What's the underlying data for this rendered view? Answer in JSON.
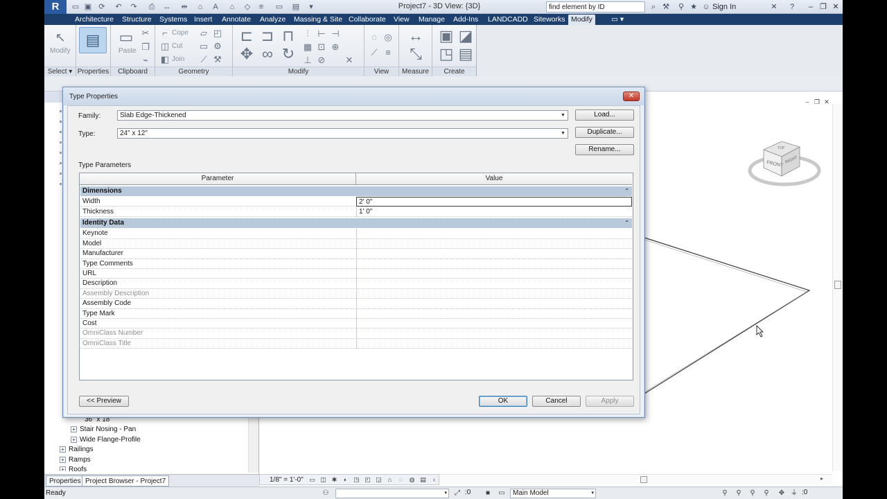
{
  "window": {
    "title": "Project7 - 3D View: {3D}"
  },
  "search": {
    "value": "find element by ID"
  },
  "account": {
    "sign_in": "Sign In"
  },
  "tabs": [
    {
      "label": "Architecture"
    },
    {
      "label": "Structure"
    },
    {
      "label": "Systems"
    },
    {
      "label": "Insert"
    },
    {
      "label": "Annotate"
    },
    {
      "label": "Analyze"
    },
    {
      "label": "Massing & Site"
    },
    {
      "label": "Collaborate"
    },
    {
      "label": "View"
    },
    {
      "label": "Manage"
    },
    {
      "label": "Add-Ins"
    },
    {
      "label": "LANDCADD"
    },
    {
      "label": "Siteworks"
    },
    {
      "label": "Modify"
    }
  ],
  "ribbon": {
    "modify_label": "Modify",
    "paste_label": "Paste",
    "cope_label": "Cope",
    "cut_label": "Cut",
    "join_label": "Join",
    "panels": {
      "select": "Select",
      "properties": "Properties",
      "clipboard": "Clipboard",
      "geometry": "Geometry",
      "modify": "Modify",
      "view": "View",
      "measure": "Measure",
      "create": "Create"
    }
  },
  "browser": {
    "header": "Project Browser - Project7",
    "tree": [
      {
        "label": "36\" x 18\"",
        "toggle": ""
      },
      {
        "label": "Stair Nosing - Pan",
        "toggle": "+"
      },
      {
        "label": "Wide Flange-Profile",
        "toggle": "+"
      },
      {
        "label": "Railings",
        "toggle": "+"
      },
      {
        "label": "Ramps",
        "toggle": "+"
      },
      {
        "label": "Roofs",
        "toggle": "+"
      }
    ],
    "tabs": [
      {
        "label": "Properties"
      },
      {
        "label": "Project Browser - Project7"
      }
    ]
  },
  "view": {
    "scale": "1/8\" = 1'-0\""
  },
  "status": {
    "text": "Ready",
    "coord": ":0",
    "model": "Main Model",
    "filter": ":0"
  },
  "dialog": {
    "title": "Type Properties",
    "family_label": "Family:",
    "family_value": "Slab Edge-Thickened",
    "type_label": "Type:",
    "type_value": "24\" x 12\"",
    "load_btn": "Load...",
    "duplicate_btn": "Duplicate...",
    "rename_btn": "Rename...",
    "type_params_label": "Type Parameters",
    "col_parameter": "Parameter",
    "col_value": "Value",
    "groups": [
      {
        "name": "Dimensions",
        "rows": [
          {
            "name": "Width",
            "value": "2'  0\"",
            "dim": false
          },
          {
            "name": "Thickness",
            "value": "1'  0\"",
            "dim": false
          }
        ]
      },
      {
        "name": "Identity Data",
        "rows": [
          {
            "name": "Keynote",
            "value": "",
            "dim": false
          },
          {
            "name": "Model",
            "value": "",
            "dim": false
          },
          {
            "name": "Manufacturer",
            "value": "",
            "dim": false
          },
          {
            "name": "Type Comments",
            "value": "",
            "dim": false
          },
          {
            "name": "URL",
            "value": "",
            "dim": false
          },
          {
            "name": "Description",
            "value": "",
            "dim": false
          },
          {
            "name": "Assembly Description",
            "value": "",
            "dim": true
          },
          {
            "name": "Assembly Code",
            "value": "",
            "dim": false
          },
          {
            "name": "Type Mark",
            "value": "",
            "dim": false
          },
          {
            "name": "Cost",
            "value": "",
            "dim": false
          },
          {
            "name": "OmniClass Number",
            "value": "",
            "dim": true
          },
          {
            "name": "OmniClass Title",
            "value": "",
            "dim": true
          }
        ]
      }
    ],
    "preview_btn": "<< Preview",
    "ok_btn": "OK",
    "cancel_btn": "Cancel",
    "apply_btn": "Apply"
  },
  "viewcube": {
    "front": "FRONT",
    "right": "RIGHT",
    "top": "TOP"
  },
  "colors": {
    "tab_bar": "#1c3f6e",
    "group_row": "#b9c9dc",
    "close_button": "#c0392b"
  }
}
